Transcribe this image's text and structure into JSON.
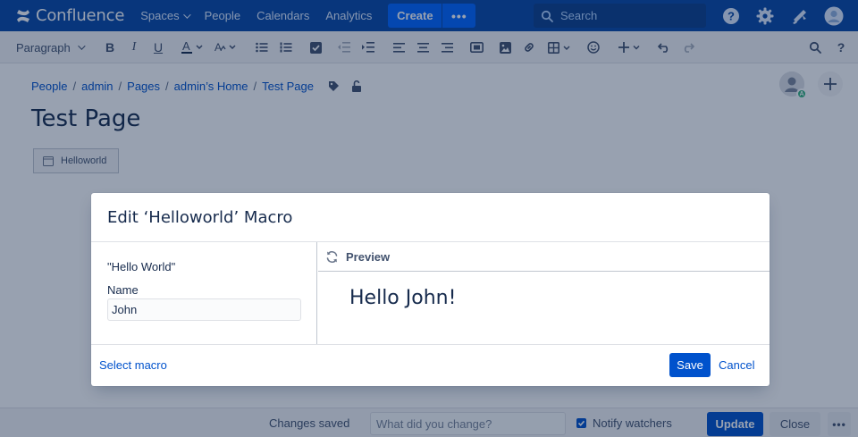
{
  "topnav": {
    "product": "Confluence",
    "links": [
      {
        "label": "Spaces",
        "dropdown": true
      },
      {
        "label": "People",
        "dropdown": false
      },
      {
        "label": "Calendars",
        "dropdown": false
      },
      {
        "label": "Analytics",
        "dropdown": false
      }
    ],
    "create_label": "Create",
    "more_label": "•••",
    "search_placeholder": "Search"
  },
  "toolbar": {
    "paragraph_label": "Paragraph"
  },
  "page": {
    "breadcrumb": [
      "People",
      "admin",
      "Pages",
      "admin’s Home",
      "Test Page"
    ],
    "title": "Test Page",
    "macro_placeholder": "Helloworld",
    "avatar_badge": "A"
  },
  "footer": {
    "changes_saved": "Changes saved",
    "change_placeholder": "What did you change?",
    "notify_label": "Notify watchers",
    "notify_checked": true,
    "update_label": "Update",
    "close_label": "Close",
    "more_label": "•••"
  },
  "dialog": {
    "title": "Edit ‘Helloworld’ Macro",
    "macro_description": "\"Hello World\"",
    "name_label": "Name",
    "name_value": "John",
    "preview_label": "Preview",
    "preview_text": "Hello John!",
    "select_macro_label": "Select macro",
    "save_label": "Save",
    "cancel_label": "Cancel"
  },
  "colors": {
    "nav_bg": "#0747A6",
    "primary": "#0052CC",
    "create_bg": "#0065FF",
    "success": "#36B37E"
  }
}
